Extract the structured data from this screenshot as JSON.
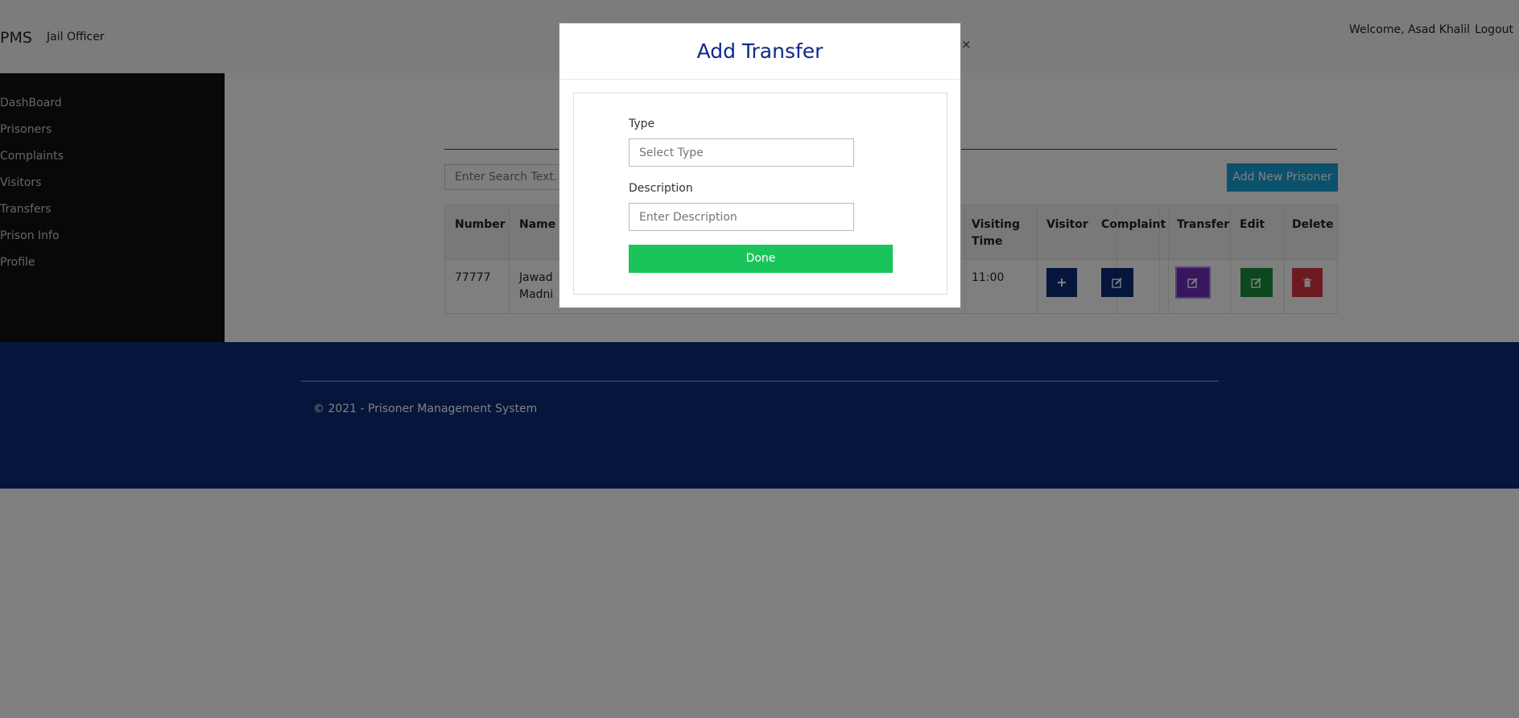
{
  "navbar": {
    "brand": "PMS",
    "role_link": "Jail Officer",
    "welcome": "Welcome, Asad Khalil",
    "logout": "Logout"
  },
  "sidebar": {
    "items": [
      {
        "label": "DashBoard"
      },
      {
        "label": "Prisoners"
      },
      {
        "label": "Complaints"
      },
      {
        "label": "Visitors"
      },
      {
        "label": "Transfers"
      },
      {
        "label": "Prison Info"
      },
      {
        "label": "Profile"
      }
    ]
  },
  "main": {
    "search_placeholder": "Enter Search Text..",
    "add_button": "Add New Prisoner",
    "table": {
      "headers": {
        "number": "Number",
        "name": "Name",
        "visiting_time_line1": "Visiting",
        "visiting_time_line2": "Time",
        "visitor": "Visitor",
        "complaint": "Complaint",
        "transfer": "Transfer",
        "edit": "Edit",
        "delete": "Delete"
      },
      "rows": [
        {
          "number": "77777",
          "name_line1": "Jawad",
          "name_line2": "Madni",
          "visiting_time": "11:00"
        }
      ]
    },
    "action_colors": {
      "visitor": "#0b2a78",
      "complaint": "#0b2a78",
      "transfer": "#6f2dbd",
      "edit": "#1a8f3c",
      "delete": "#dc3545"
    }
  },
  "footer": {
    "text": "© 2021 - Prisoner Management System"
  },
  "modal": {
    "title": "Add Transfer",
    "close": "×",
    "type_label": "Type",
    "type_placeholder": "Select Type",
    "description_label": "Description",
    "description_placeholder": "Enter Description",
    "done_button": "Done"
  }
}
